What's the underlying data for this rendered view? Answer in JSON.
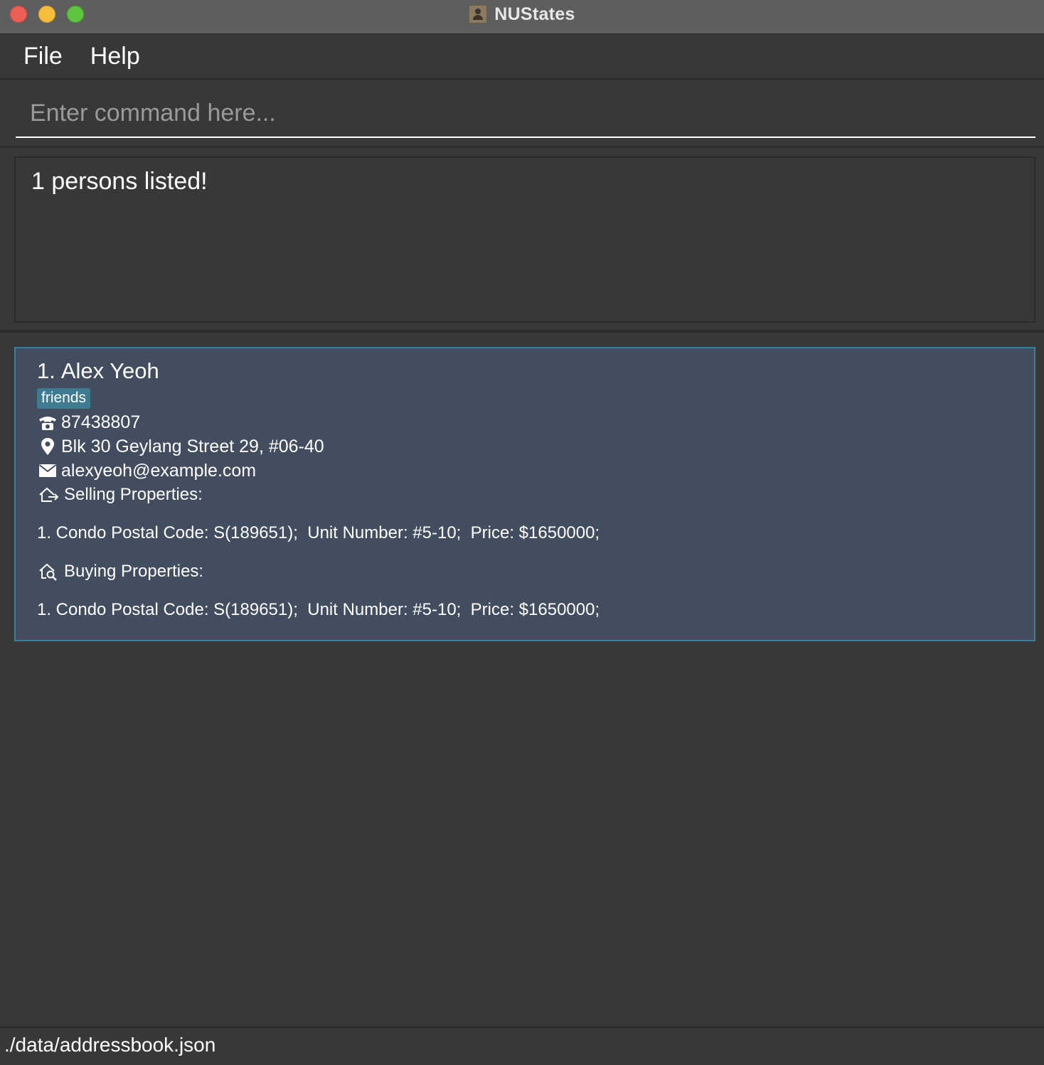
{
  "window": {
    "title": "NUStates",
    "app_icon": "contacts-app-icon",
    "controls": [
      "close",
      "minimize",
      "maximize"
    ]
  },
  "menu": {
    "items": [
      {
        "label": "File"
      },
      {
        "label": "Help"
      }
    ]
  },
  "command_box": {
    "placeholder": "Enter command here...",
    "value": ""
  },
  "result_display": {
    "text": "1 persons listed!"
  },
  "persons": [
    {
      "index": "1.",
      "name": "Alex Yeoh",
      "tags": [
        "friends"
      ],
      "phone": "87438807",
      "address": "Blk 30 Geylang Street 29, #06-40",
      "email": "alexyeoh@example.com",
      "selling_label": "Selling Properties:",
      "selling_properties": [
        "1. Condo Postal Code: S(189651);  Unit Number: #5-10;  Price: $1650000;"
      ],
      "buying_label": "Buying Properties:",
      "buying_properties": [
        "1. Condo Postal Code: S(189651);  Unit Number: #5-10;  Price: $1650000;"
      ]
    }
  ],
  "status_bar": {
    "file_path": "./data/addressbook.json"
  },
  "colors": {
    "background": "#383838",
    "card_background": "#424e60",
    "card_border": "#3c7d9a",
    "tag_background": "#3e7b91",
    "titlebar": "#5f5e5e"
  }
}
